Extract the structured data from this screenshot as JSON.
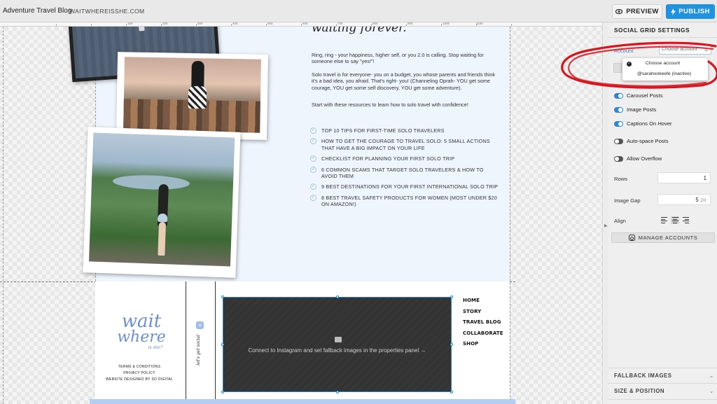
{
  "header": {
    "site_name": "Adventure Travel Blog",
    "site_url": "WAITWHEREISSHE.COM",
    "preview_label": "PREVIEW",
    "publish_label": "PUBLISH"
  },
  "ruler": {
    "ticks": [
      "100",
      "200",
      "300",
      "400",
      "500",
      "600",
      "700",
      "800",
      "900",
      "1000",
      "1100"
    ]
  },
  "page": {
    "heading": "waiting forever.",
    "paragraphs": [
      "Ring, ring - your happiness, higher self, or you 2.0 is calling. Stop waiting for someone else to say \"yes!\"!",
      "Solo travel is for everyone- you on a budget, you whose parents and friends think it's a bad idea, you afraid. That's right- you! (Channeling Oprah- YOU get some courage, YOU get some self discovery, YOU get some adventure).",
      "Start with these resources to learn how to solo travel with confidence!"
    ],
    "resources": [
      "Top 10 Tips for First-Time Solo Travelers",
      "How to Get the Courage to Travel Solo: 5 Small Actions That Have a Big Impact on Your Life",
      "Checklist for Planning Your First Solo Trip",
      "6 Common Scams That Target Solo Travelers & How to Avoid Them",
      "9 Best Destinations for Your First International Solo Trip",
      "8 Best Travel Safety Products for Women (Most Under $20 on Amazon!)"
    ]
  },
  "footer": {
    "logo_line1": "wait",
    "logo_line2": "where",
    "logo_line3": "is she?",
    "links": [
      "Terms & Conditions",
      "Privacy Policy",
      "Website designed by SO Digital"
    ],
    "vertical_text": "let's get social",
    "feed_message": "Connect to Instagram and set fallback images in the properties panel →",
    "nav": [
      "HOME",
      "STORY",
      "TRAVEL BLOG",
      "COLLABORATE",
      "SHOP"
    ]
  },
  "panel": {
    "title": "SOCIAL GRID SETTINGS",
    "account_label": "Account",
    "account_value": "Choose account",
    "dropdown_options": [
      "Choose account",
      "@sarahxokeefe (inactive)"
    ],
    "toggles": [
      {
        "label": "Carousel Posts",
        "on": true
      },
      {
        "label": "Image Posts",
        "on": true
      },
      {
        "label": "Captions On Hover",
        "on": true
      },
      {
        "label": "Auto-space Posts",
        "on": false
      },
      {
        "label": "Allow Overflow",
        "on": false
      }
    ],
    "rows_label": "Rows",
    "rows_value": "1",
    "gap_label": "Image Gap",
    "gap_value": "5",
    "gap_unit": "px",
    "align_label": "Align",
    "manage_label": "MANAGE ACCOUNTS",
    "fallback_label": "FALLBACK IMAGES",
    "size_label": "SIZE & POSITION"
  },
  "colors": {
    "publish": "#1f92e0",
    "toggle_on": "#2f86d6",
    "annotation": "#d8141c",
    "logo": "#6b8fd6"
  }
}
